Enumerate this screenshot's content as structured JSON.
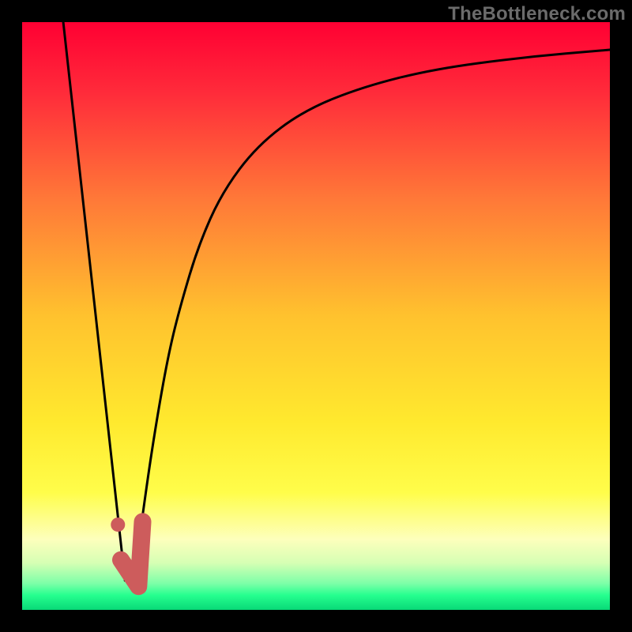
{
  "watermark": "TheBottleneck.com",
  "chart_data": {
    "type": "line",
    "title": "",
    "xlabel": "",
    "ylabel": "",
    "xlim": [
      0,
      100
    ],
    "ylim": [
      0,
      100
    ],
    "grid": false,
    "legend": false,
    "gradient_stops": [
      {
        "pos": 0.0,
        "color": "#ff0033"
      },
      {
        "pos": 0.12,
        "color": "#ff2b3a"
      },
      {
        "pos": 0.3,
        "color": "#ff7838"
      },
      {
        "pos": 0.5,
        "color": "#ffc22e"
      },
      {
        "pos": 0.68,
        "color": "#ffe92e"
      },
      {
        "pos": 0.8,
        "color": "#fffd4a"
      },
      {
        "pos": 0.88,
        "color": "#fdffbc"
      },
      {
        "pos": 0.92,
        "color": "#d6ffb4"
      },
      {
        "pos": 0.955,
        "color": "#7dffa8"
      },
      {
        "pos": 0.975,
        "color": "#26ff8f"
      },
      {
        "pos": 1.0,
        "color": "#08d977"
      }
    ],
    "series": [
      {
        "name": "left-line",
        "x": [
          7,
          17.5
        ],
        "y": [
          100,
          5
        ]
      },
      {
        "name": "right-curve",
        "x": [
          19,
          21,
          23,
          25,
          27,
          30,
          34,
          40,
          48,
          58,
          70,
          85,
          100
        ],
        "y": [
          5,
          20,
          33,
          44,
          52,
          62,
          71,
          79,
          85,
          89,
          92,
          94,
          95.3
        ]
      }
    ],
    "marker": {
      "name": "highlight-blob",
      "color": "#cd5c5c",
      "points": [
        {
          "x": 16.3,
          "y": 14.5
        },
        {
          "x": 16.8,
          "y": 8.5
        },
        {
          "x": 19.8,
          "y": 4.0
        },
        {
          "x": 20.5,
          "y": 15.0
        }
      ]
    }
  }
}
